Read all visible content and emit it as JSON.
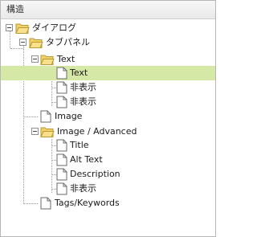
{
  "panel": {
    "title": "構造"
  },
  "tree": {
    "root": {
      "label": "ダイアログ",
      "icon": "folder-open-icon",
      "expanded": true
    },
    "tabpanel": {
      "label": "タブパネル",
      "icon": "folder-open-icon",
      "expanded": true
    },
    "text_folder": {
      "label": "Text",
      "icon": "folder-open-icon",
      "expanded": true
    },
    "text_item": {
      "label": "Text",
      "icon": "document-icon",
      "selected": true
    },
    "hidden_1": {
      "label": "非表示",
      "icon": "document-icon"
    },
    "hidden_2": {
      "label": "非表示",
      "icon": "document-icon"
    },
    "image_item": {
      "label": "Image",
      "icon": "document-icon"
    },
    "image_adv_folder": {
      "label": "Image / Advanced",
      "icon": "folder-open-icon",
      "expanded": true
    },
    "title_item": {
      "label": "Title",
      "icon": "document-icon"
    },
    "alt_text_item": {
      "label": "Alt Text",
      "icon": "document-icon"
    },
    "description_item": {
      "label": "Description",
      "icon": "document-icon"
    },
    "hidden_3": {
      "label": "非表示",
      "icon": "document-icon"
    },
    "tags_item": {
      "label": "Tags/Keywords",
      "icon": "document-icon"
    }
  },
  "colors": {
    "selection": "#d6e8a5",
    "folder": "#f2d169",
    "folder_stroke": "#b89a36"
  }
}
